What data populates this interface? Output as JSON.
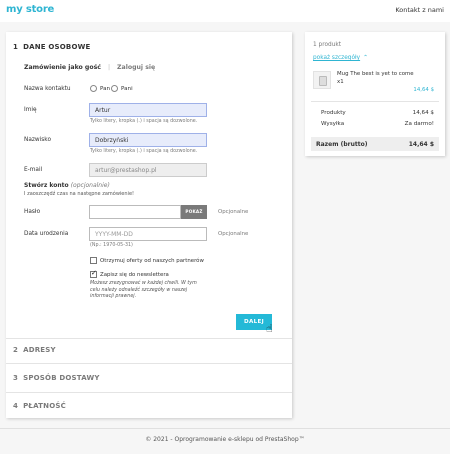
{
  "header": {
    "logo_text": "my store",
    "contact_link": "Kontakt z nami"
  },
  "checkout": {
    "step1": {
      "number": "1",
      "title": "DANE OSOBOWE"
    },
    "tabs": {
      "guest": "Zamówienie jako gość",
      "separator": "|",
      "login": "Zaloguj się"
    },
    "form": {
      "contact_title_label": "Nazwa kontaktu",
      "title_options": [
        "Pan",
        "Pani"
      ],
      "first_name_label": "Imię",
      "first_name_value": "Artur",
      "first_name_hint": "Tylko litery, kropka (.) i spacja są dozwolone.",
      "last_name_label": "Nazwisko",
      "last_name_value": "Dobrzyński",
      "last_name_hint": "Tylko litery, kropka (.) i spacja są dozwolone.",
      "email_label": "E-mail",
      "email_value": "artur@prestashop.pl",
      "create_account_title": "Stwórz konto",
      "create_account_optional": "(opcjonalnie)",
      "create_account_subtitle": "I zaoszczędź czas na następne zamówienie!",
      "password_label": "Hasło",
      "show_button": "POKAŻ",
      "password_optional": "Opcjonalne",
      "birthdate_label": "Data urodzenia",
      "birthdate_placeholder": "YYYY-MM-DD",
      "birthdate_optional": "Opcjonalne",
      "birthdate_hint": "(Np.: 1970-05-31)",
      "partner_offers_label": "Otrzymuj oferty od naszych partnerów",
      "partner_offers_checked": false,
      "newsletter_label": "Zapisz się do newslettera",
      "newsletter_checked": true,
      "newsletter_note": "Możesz zrezygnować w każdej chwili. W tym celu należy odnaleźć szczegóły w naszej informacji prawnej.",
      "next_button": "DALEJ"
    },
    "step2": {
      "number": "2",
      "title": "ADRESY"
    },
    "step3": {
      "number": "3",
      "title": "SPOSÓB DOSTAWY"
    },
    "step4": {
      "number": "4",
      "title": "PŁATNOŚĆ"
    }
  },
  "summary": {
    "product_count": "1 produkt",
    "details_link": "pokaż szczegóły",
    "item": {
      "name": "Mug The best is yet to come",
      "quantity": "x1",
      "price": "14,64 $"
    },
    "products_label": "Produkty",
    "products_value": "14,64 $",
    "shipping_label": "Wysyłka",
    "shipping_value": "Za darmo!",
    "total_label": "Razem (brutto)",
    "total_value": "14,64 $"
  },
  "footer": {
    "text": "© 2021 - Oprogramowanie e-sklepu od PrestaShop™"
  },
  "colors": {
    "accent": "#24b9d7",
    "link": "#2fb5d2",
    "field_filled": "#e7ecfb"
  },
  "icons": {
    "chevron": "chevron-up-icon",
    "cursor": "hand-pointer-icon",
    "thumb": "product-thumbnail"
  }
}
